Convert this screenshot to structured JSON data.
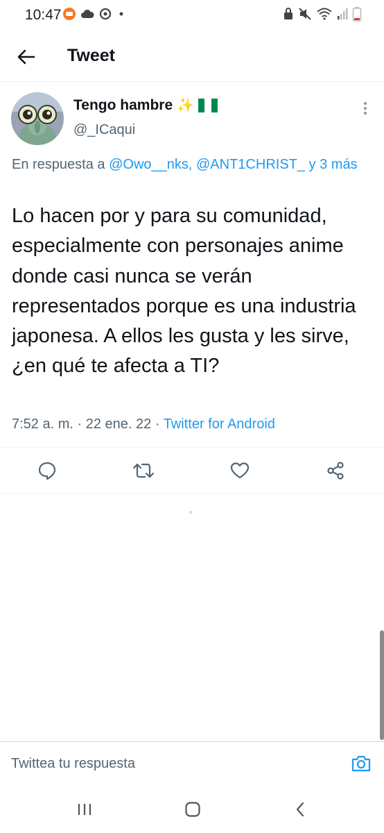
{
  "status_bar": {
    "time": "10:47",
    "left_icons": [
      "app-notification-icon",
      "cloud-icon",
      "sync-icon",
      "dot-icon"
    ],
    "right_icons": [
      "lock-icon",
      "mute-icon",
      "wifi-icon",
      "signal-icon",
      "battery-icon"
    ]
  },
  "header": {
    "title": "Tweet",
    "back_icon": "arrow-left-icon"
  },
  "tweet": {
    "author": {
      "display_name": "Tengo hambre",
      "emoji": "✨",
      "flag": "nigeria-flag",
      "handle": "@_ICaqui"
    },
    "reply_context": {
      "prefix": "En respuesta a",
      "mentions": "@Owo__nks, @ANT1CHRIST_ y 3 más"
    },
    "text": "Lo hacen por y para su comunidad, especialmente con personajes anime donde casi nunca se verán representados porque es una industria japonesa. A ellos les gusta y les sirve, ¿en qué te afecta a TI?",
    "meta": {
      "time": "7:52 a. m.",
      "date": "22 ene. 22",
      "separator": "·",
      "source": "Twitter for Android"
    },
    "actions": [
      "reply-icon",
      "retweet-icon",
      "like-icon",
      "share-icon"
    ]
  },
  "composer": {
    "placeholder": "Twittea tu respuesta",
    "camera_icon": "camera-icon"
  },
  "colors": {
    "accent": "#1d9bf0",
    "secondary_text": "#536471",
    "primary_text": "#0f1419",
    "divider": "#eff3f4"
  },
  "nav_bar": {
    "buttons": [
      "recents-icon",
      "home-icon",
      "back-icon"
    ]
  }
}
